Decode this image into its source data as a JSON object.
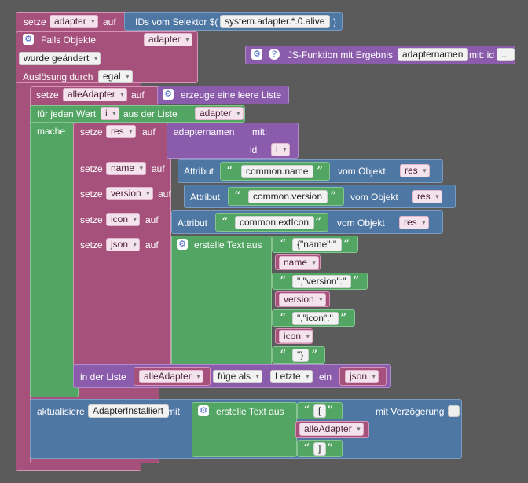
{
  "row1": {
    "set_label": "setze",
    "var": "adapter",
    "auf": "auf",
    "selector_label": "IDs vom Selektor $(",
    "selector_value": "system.adapter.*.0.alive",
    "close_paren": ")"
  },
  "trigger": {
    "label": "Falls Objekte",
    "var": "adapter",
    "changed": "wurde geändert",
    "caused_by": "Auslösung durch",
    "cause_value": "egal"
  },
  "jsfunc": {
    "label": "JS-Funktion mit Ergebnis",
    "name": "adapternamen",
    "with_label": "mit: id",
    "more": "..."
  },
  "list": {
    "set_label": "setze",
    "var": "alleAdapter",
    "auf": "auf",
    "create_label": "erzeuge eine leere Liste"
  },
  "foreach": {
    "label": "für jeden Wert",
    "var": "i",
    "from_label": "aus der Liste",
    "list_var": "adapter",
    "do_label": "mache"
  },
  "res": {
    "set_label": "setze",
    "var": "res",
    "auf": "auf",
    "call_name": "adapternamen",
    "with": "mit:",
    "param": "id",
    "arg": "i"
  },
  "name": {
    "set_label": "setze",
    "var": "name",
    "auf": "auf",
    "attr_label": "Attribut",
    "attr_value": "common.name",
    "obj_label": "vom Objekt",
    "obj_var": "res"
  },
  "version": {
    "set_label": "setze",
    "var": "version",
    "auf": "auf",
    "attr_label": "Attribut",
    "attr_value": "common.version",
    "obj_label": "vom Objekt",
    "obj_var": "res"
  },
  "icon": {
    "set_label": "setze",
    "var": "icon",
    "auf": "auf",
    "attr_label": "Attribut",
    "attr_value": "common.extIcon",
    "obj_label": "vom Objekt",
    "obj_var": "res"
  },
  "json": {
    "set_label": "setze",
    "var": "json",
    "auf": "auf",
    "create_label": "erstelle Text aus",
    "parts": [
      "{\"name\":\"",
      "name",
      "\",\"version\":\"",
      "version",
      "\",\"icon\":\"",
      "icon",
      "\"}"
    ]
  },
  "listadd": {
    "label": "in der Liste",
    "list_var": "alleAdapter",
    "mode": "füge als",
    "position": "Letzte",
    "in": "ein",
    "item_var": "json"
  },
  "update": {
    "label": "aktualisiere",
    "target": "AdapterInstalliert",
    "with": "mit",
    "create_label": "erstelle Text aus",
    "parts": [
      "[",
      "alleAdapter",
      "]"
    ],
    "delay_label": "mit Verzögerung"
  },
  "icons": {
    "gear": "gear-icon",
    "help": "help-icon",
    "dropdown": "chevron-down-icon"
  },
  "colors": {
    "background": "#5b5b5b",
    "variable": "#a5517c",
    "object": "#4f77a3",
    "function": "#8a5cab",
    "text": "#53a564"
  }
}
